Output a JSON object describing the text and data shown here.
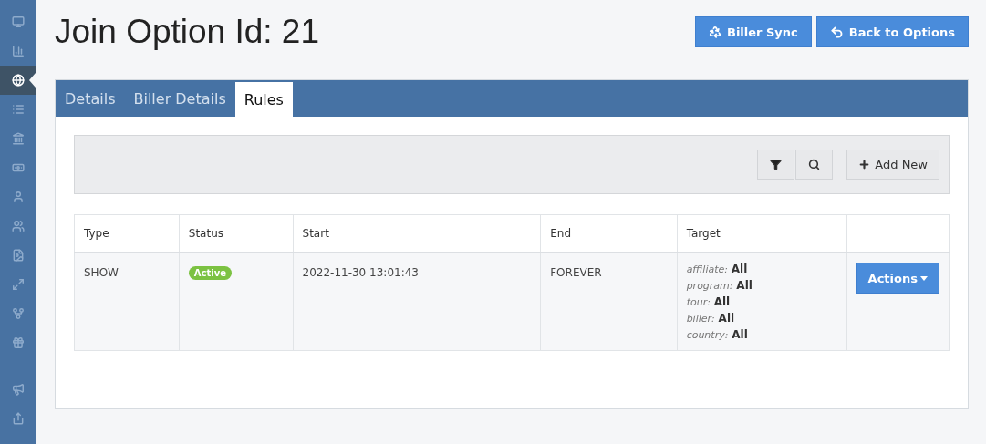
{
  "sidebar": {
    "groups": [
      [
        {
          "selected": false
        },
        {
          "selected": false
        },
        {
          "selected": true
        },
        {
          "selected": false
        },
        {
          "selected": false
        },
        {
          "selected": false
        },
        {
          "selected": false
        },
        {
          "selected": false
        },
        {
          "selected": false
        },
        {
          "selected": false
        },
        {
          "selected": false
        },
        {
          "selected": false
        }
      ],
      [
        {
          "selected": false
        },
        {
          "selected": false
        }
      ]
    ]
  },
  "title": "Join Option Id: 21",
  "header_buttons": [
    "Biller Sync",
    "Back to Options"
  ],
  "tabs": [
    {
      "label": "Details",
      "selected": false
    },
    {
      "label": "Biller Details",
      "selected": false
    },
    {
      "label": "Rules",
      "selected": true
    }
  ],
  "toolbar": {
    "add_button": "Add New"
  },
  "table": {
    "columns": [
      "Type",
      "Status",
      "Start",
      "End",
      "Target"
    ],
    "rows": [
      {
        "type": "SHOW",
        "status": "Active",
        "start": "2022-11-30 13:01:43",
        "end": "FOREVER",
        "target": [
          {
            "label": "affiliate:",
            "value": "All"
          },
          {
            "label": "program:",
            "value": "All"
          },
          {
            "label": "tour:",
            "value": "All"
          },
          {
            "label": "biller:",
            "value": "All"
          },
          {
            "label": "country:",
            "value": "All"
          }
        ],
        "action": "Actions"
      }
    ]
  }
}
